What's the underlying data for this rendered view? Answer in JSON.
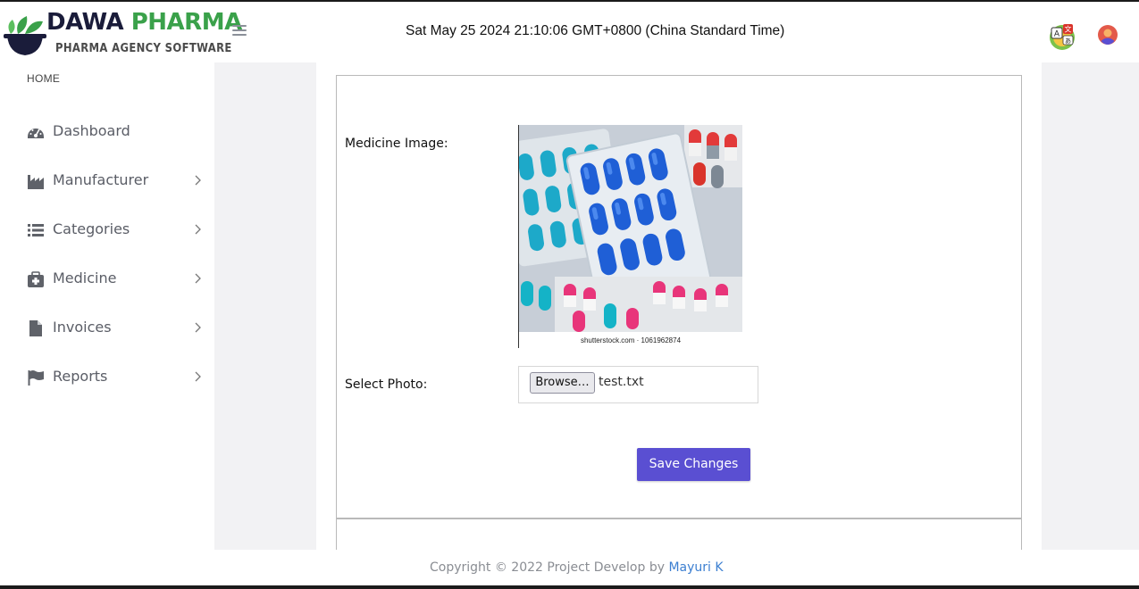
{
  "header": {
    "logo_title_part1": "DAWA",
    "logo_title_part2": "PHARMA",
    "logo_subtitle": "PHARMA AGENCY SOFTWARE",
    "datetime": "Sat May 25 2024 21:10:06 GMT+0800 (China Standard Time)",
    "icons": [
      "menu-icon",
      "language-icon",
      "profile-icon"
    ]
  },
  "sidebar": {
    "section": "HOME",
    "items": [
      {
        "label": "Dashboard",
        "icon": "dashboard-icon",
        "has_submenu": false
      },
      {
        "label": "Manufacturer",
        "icon": "factory-icon",
        "has_submenu": true
      },
      {
        "label": "Categories",
        "icon": "list-icon",
        "has_submenu": true
      },
      {
        "label": "Medicine",
        "icon": "medical-kit-icon",
        "has_submenu": true
      },
      {
        "label": "Invoices",
        "icon": "file-icon",
        "has_submenu": true
      },
      {
        "label": "Reports",
        "icon": "flag-icon",
        "has_submenu": true
      }
    ]
  },
  "form": {
    "image_label": "Medicine Image:",
    "image_caption": "shutterstock.com · 1061962874",
    "photo_label": "Select Photo:",
    "browse_label": "Browse…",
    "file_name": "test.txt",
    "save_label": "Save Changes"
  },
  "footer": {
    "text": "Copyright © 2022 Project Develop by",
    "link": "Mayuri K"
  },
  "colors": {
    "accent": "#5a4fd2",
    "logo_dark": "#1a1c3a",
    "logo_green": "#3aa14a",
    "link": "#3c7fd1"
  }
}
